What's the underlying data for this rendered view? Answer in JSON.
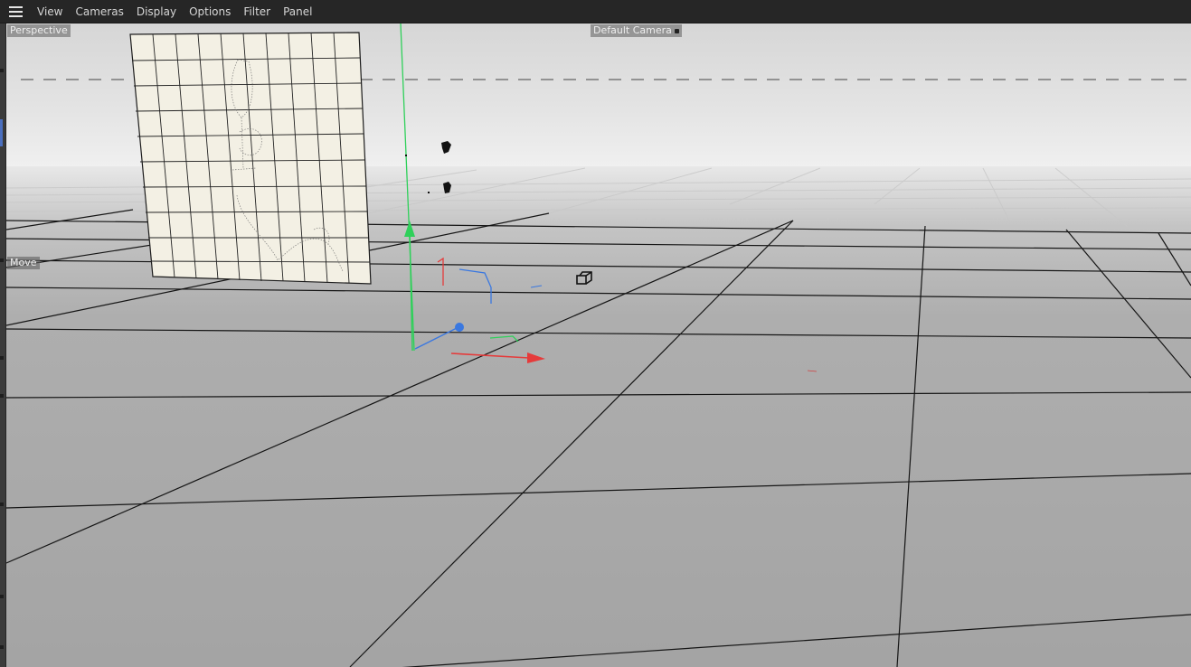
{
  "menubar": {
    "items": [
      {
        "label": "View"
      },
      {
        "label": "Cameras"
      },
      {
        "label": "Display"
      },
      {
        "label": "Options"
      },
      {
        "label": "Filter"
      },
      {
        "label": "Panel"
      }
    ],
    "menu_icon": "hamburger-menu-icon"
  },
  "viewport": {
    "projection_label": "Perspective",
    "camera_label": "Default Camera",
    "camera_icon": "camera-dot-icon",
    "tool_label": "Move",
    "colors": {
      "sky_top": "#d9d9d9",
      "horizon": "#eeeeee",
      "floor": "#a6a6a6",
      "grid_major": "#111111",
      "axis_x": "#e53b3b",
      "axis_y": "#2fd05a",
      "axis_z": "#3a78e0",
      "plane_fill": "#f3f0e4"
    },
    "objects": {
      "textured_plane": "textured-plane-object",
      "move_gizmo": "move-gizmo-icon",
      "null_objects": "null-object-icon",
      "world_axis": "world-y-axis-line"
    }
  }
}
